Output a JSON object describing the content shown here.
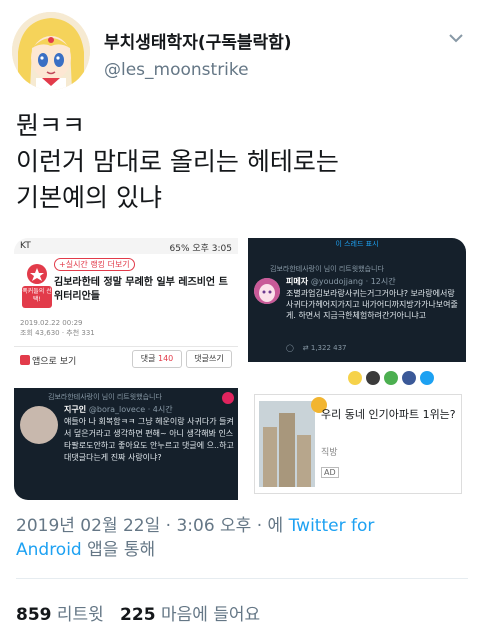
{
  "profile": {
    "display_name": "부치생태학자(구독블락함)",
    "handle": "@les_moonstrike",
    "avatar_icon": "sailor-moon-avatar-icon",
    "menu_icon": "chevron-down-icon"
  },
  "tweet": {
    "lines": [
      "뭔ㅋㅋ",
      "이런거 맘대로 올리는 헤테로는",
      "기본예의 있냐"
    ]
  },
  "media": {
    "panel_a": {
      "status_left": "KT",
      "status_right": "65% 오후 3:05",
      "tag": "+실시간 랭킹 더보기",
      "badge": "폭커들의 선택!",
      "title": "김보라한테 정말 무례한 일부 레즈비언 트위터리안들",
      "meta_date": "2019.02.22 00:29",
      "meta_views": "조회 43,630 · 추천 331",
      "app_label": "앱으로 보기",
      "comment_label": "댓글",
      "comment_count": "140",
      "write_label": "댓글쓰기"
    },
    "panel_b": {
      "top_bar": "이 스레드 표시",
      "retweeted": "김보라한테사랑이 님이 리트윗했습니다",
      "name": "피메자",
      "handle": "@youdojjang · 12시간",
      "body": "조별과업김보라랑사귀는거그거아냐? 보라랑에서랑사귀다가헤어지가지고 내가어디까지방가가나보여줄게. 하면서 지금극한체험하려간거아니냐고",
      "actions": "1,322    437"
    },
    "panel_c": {
      "retweeted": "김보라한테사랑이 님이 리트윗했습니다",
      "name": "지구인",
      "handle": "@bora_lovece · 4시간",
      "body": "얘들아 나 회복함ㅋㅋ 그냥 헤운이랑 사귀다가 들켜서 덮은거라고 생각하면 편해~ 아니 생각해봐 인스타팔로도안하고 좋아요도 안누르고 댓글에 으..하고 대댓글다는게 진짜 사랑이냐?"
    },
    "panel_d": {
      "ad_title": "우리 동네 인기아파트 1위는?",
      "ad_source": "직방",
      "ad_label": "AD"
    }
  },
  "timestamp": {
    "text": "2019년 02월 22일 · 3:06 오후 · 에 ",
    "link_line1": "Twitter for",
    "link_line2": "Android",
    "suffix": " 앱을 통해"
  },
  "stats": {
    "retweets": "859",
    "retweets_label": "리트윗",
    "likes": "225",
    "likes_label": "마음에 들어요"
  },
  "colors": {
    "link": "#1da1f2",
    "secondary": "#657786",
    "dark_bg": "#15202b"
  }
}
